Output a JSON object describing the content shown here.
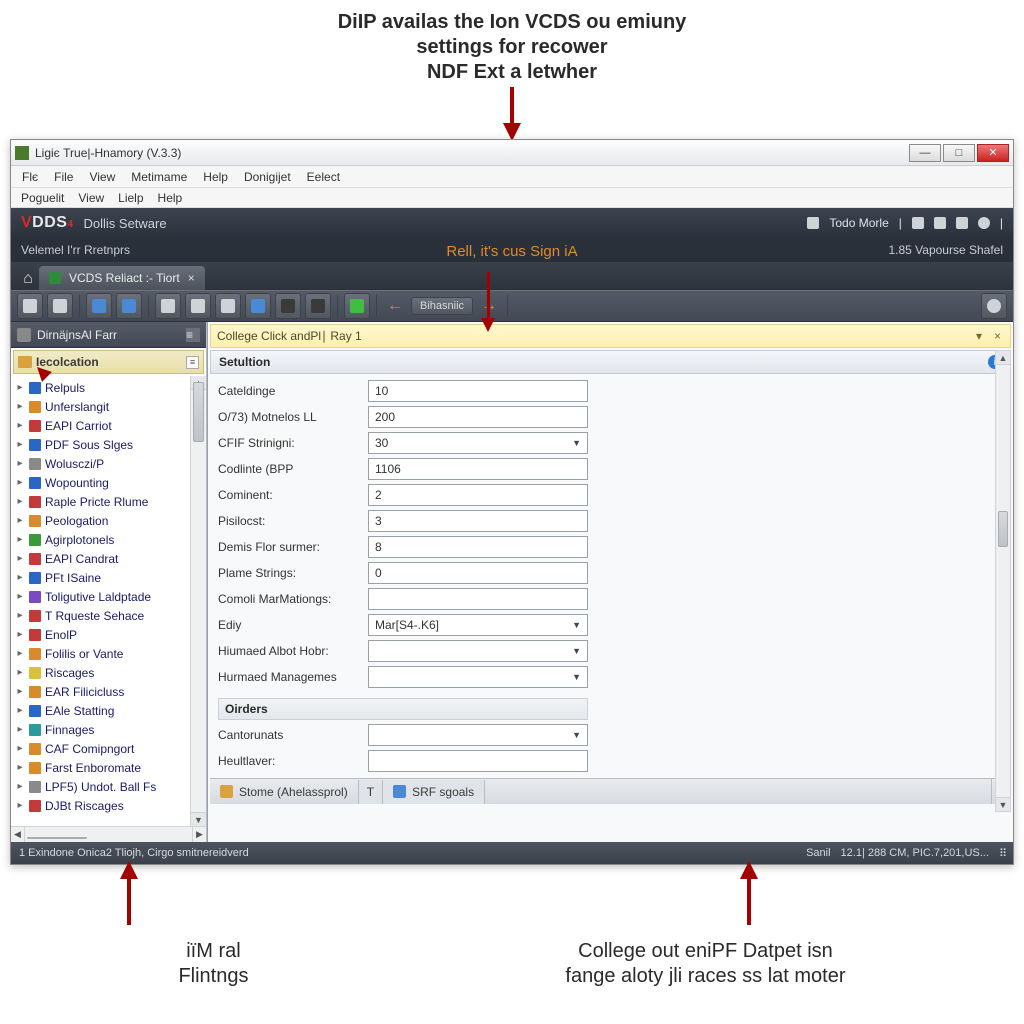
{
  "annotations": {
    "top_line1": "DiIP availas the Ion VCDS ou emiuny",
    "top_line2": "settings for recower",
    "top_line3": "NDF Ext a letwher",
    "bottom_left_line1": "iïM ral",
    "bottom_left_line2": "Flintngs",
    "bottom_right_line1": "College out eniPF Datpet isn",
    "bottom_right_line2": "fange aloty jli races ss lat moter"
  },
  "titlebar": {
    "text": "Ligiє True|-Hnamory (V.3.3)"
  },
  "menubar1": [
    "Flє",
    "File",
    "View",
    "Metimame",
    "Help",
    "Donigijet",
    "Eelect"
  ],
  "menubar2": [
    "Poguelit",
    "View",
    "Lielp",
    "Help"
  ],
  "brand": {
    "logo_v": "V",
    "logo_rest": "DDS",
    "logo_small": "4",
    "subtitle": "Dollis Setware",
    "right_label": "Todo Morle"
  },
  "subbrand": {
    "left": "Velemel I'rr Rretnprs",
    "center": "Rell, it's cus Sign iA",
    "right": "1.85 Vapourse Shafel"
  },
  "tab": {
    "label": "VCDS Reliact :- Tiort"
  },
  "toolbar_label": "Bihasniic",
  "sidebar": {
    "header": "DirnäjnsAl Farr",
    "subheader": "Iecolcation",
    "items": [
      {
        "icon": "c-blue",
        "label": "Relpuls"
      },
      {
        "icon": "c-orange",
        "label": "Unferslangit"
      },
      {
        "icon": "c-red",
        "label": "EAPI Carriot"
      },
      {
        "icon": "c-blue",
        "label": "PDF Sous Slges"
      },
      {
        "icon": "c-gray",
        "label": "Wolusczi/P"
      },
      {
        "icon": "c-blue",
        "label": "Wopounting"
      },
      {
        "icon": "c-red",
        "label": "Raple Pricte Rlume"
      },
      {
        "icon": "c-orange",
        "label": "Peologation"
      },
      {
        "icon": "c-green",
        "label": "Agirplotonels"
      },
      {
        "icon": "c-red",
        "label": "EAPI Candrat"
      },
      {
        "icon": "c-blue",
        "label": "PFt ISaine"
      },
      {
        "icon": "c-purple",
        "label": "Toligutive Laldptade"
      },
      {
        "icon": "c-red",
        "label": "T Rqueste Sehace"
      },
      {
        "icon": "c-red",
        "label": "EnolP"
      },
      {
        "icon": "c-orange",
        "label": "Folilis or Vante"
      },
      {
        "icon": "c-yellow",
        "label": "Riscages"
      },
      {
        "icon": "c-orange",
        "label": "EAR Filicicluss"
      },
      {
        "icon": "c-blue",
        "label": "EAle Statting"
      },
      {
        "icon": "c-teal",
        "label": "Finnages"
      },
      {
        "icon": "c-orange",
        "label": "CAF Comipngort"
      },
      {
        "icon": "c-orange",
        "label": "Farst Enboromate"
      },
      {
        "icon": "c-gray",
        "label": "LPF5) Undot. Ball Fs"
      },
      {
        "icon": "c-red",
        "label": "DJBt Riscages"
      }
    ]
  },
  "infobar": {
    "text": "College Click andPl∣ Ray 1"
  },
  "panel": {
    "title": "Setultion"
  },
  "form": {
    "rows": [
      {
        "label": "Cateldinge",
        "value": "10",
        "type": "inp"
      },
      {
        "label": "O/73) Motnelos LL",
        "value": "200",
        "type": "inp"
      },
      {
        "label": "CFIF Strinigni:",
        "value": "30",
        "type": "sel"
      },
      {
        "label": "Codlinte (BPP",
        "value": "1106",
        "type": "inp"
      },
      {
        "label": "Cominent:",
        "value": "2",
        "type": "inp"
      },
      {
        "label": "Pisilocst:",
        "value": "3",
        "type": "inp"
      },
      {
        "label": "Demis Flor surmer:",
        "value": "8",
        "type": "inp"
      },
      {
        "label": "Plame Strings:",
        "value": "0",
        "type": "inp"
      },
      {
        "label": "Comoli MarMationgs:",
        "value": "",
        "type": "inp"
      },
      {
        "label": "Ediy",
        "value": "Mar[S4-.K6]",
        "type": "sel"
      },
      {
        "label": "Hiumaed Albot Hobr:",
        "value": "",
        "type": "sel"
      },
      {
        "label": "Hurmaed Managemes",
        "value": "",
        "type": "sel"
      }
    ],
    "section2": "Oirders",
    "rows2": [
      {
        "label": "Cantorunats",
        "value": "",
        "type": "sel"
      },
      {
        "label": "Heultlaver:",
        "value": "",
        "type": "inp"
      }
    ]
  },
  "bottom_tabs": {
    "left_icon_label": "Stome (Ahelassprol)",
    "sep": "T",
    "right_label": "SRF sgoals"
  },
  "statusbar": {
    "left": "1 Exindone Onica2 Tliojh, Cirgo smitnereidverd",
    "r1": "Sanil",
    "r2": "12.1| 288 CM, PIC.7,201,US..."
  }
}
